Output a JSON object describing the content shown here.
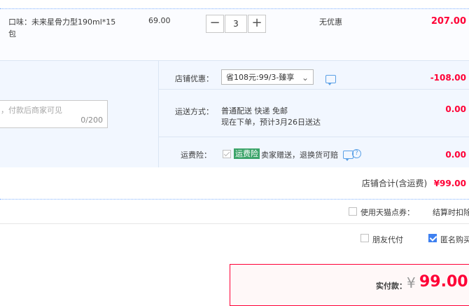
{
  "product": {
    "attribute_text": "口味：未来星骨力型190ml*15包",
    "unit_price": "69.00",
    "quantity": "3",
    "minus_symbol": "−",
    "plus_symbol": "+",
    "discount_text": "无优惠",
    "line_total": "207.00"
  },
  "store": {
    "memo": {
      "placeholder": "，付款后商家可见",
      "counter": "0/200"
    },
    "promotion": {
      "label": "店铺优惠：",
      "selected": "省108元:99/3-臻享",
      "amount": "-108.00"
    },
    "shipping": {
      "label": "运送方式：",
      "line1": "普通配送 快递 免邮",
      "line2": "现在下单，预计3月26日送达",
      "amount": "0.00"
    },
    "insurance": {
      "label": "运费险：",
      "tag": "运费险",
      "text": "卖家赠送，退换货可赔",
      "help": "?",
      "amount": "0.00"
    },
    "total": {
      "label": "店铺合计(含运费)",
      "amount": "¥99.00"
    }
  },
  "points": {
    "label": "使用天猫点券：",
    "note": "结算时扣除"
  },
  "options": {
    "friend_pay": "朋友代付",
    "anonymous": "匿名购买"
  },
  "payment": {
    "label": "实付款：",
    "currency": "¥",
    "amount": "99.00"
  },
  "colors": {
    "accent_red": "#ff0036",
    "link_blue": "#3e80f0",
    "section_bg": "#f2f7ff"
  }
}
